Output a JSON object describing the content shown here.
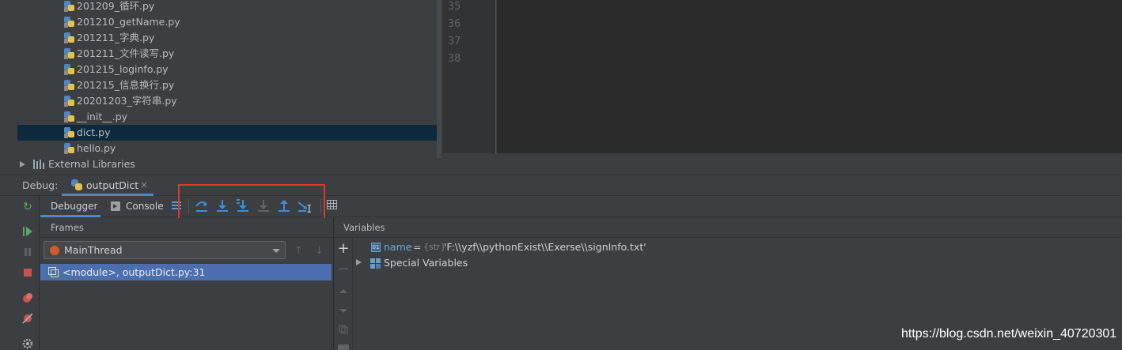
{
  "project_tree": {
    "files": [
      {
        "label": "201209_循环.py",
        "selected": false
      },
      {
        "label": "201210_getName.py",
        "selected": false
      },
      {
        "label": "201211_字典.py",
        "selected": false
      },
      {
        "label": "201211_文件读写.py",
        "selected": false
      },
      {
        "label": "201215_loginfo.py",
        "selected": false
      },
      {
        "label": "201215_信息换行.py",
        "selected": false
      },
      {
        "label": "20201203_字符串.py",
        "selected": false
      },
      {
        "label": "__init__.py",
        "selected": false
      },
      {
        "label": "dict.py",
        "selected": true
      },
      {
        "label": "hello.py",
        "selected": false
      }
    ],
    "external_libraries": "External Libraries"
  },
  "editor": {
    "line_numbers": [
      "35",
      "36",
      "37",
      "38"
    ]
  },
  "debug": {
    "label": "Debug:",
    "run_config": "outputDict",
    "close_glyph": "×",
    "tabs": {
      "debugger": "Debugger",
      "console": "Console"
    },
    "frames_title": "Frames",
    "variables_title": "Variables",
    "thread": "MainThread",
    "frame": "<module>, outputDict.py:31",
    "variables": {
      "name": "name",
      "eq": "=",
      "type": "{str}",
      "value": "'F:\\\\yzf\\\\pythonExist\\\\Exerse\\\\signInfo.txt'",
      "special": "Special Variables"
    },
    "toolbar_buttons": [
      "step-over",
      "step-into",
      "step-into-my-code",
      "force-step-into",
      "step-out",
      "run-to-cursor"
    ],
    "colors": {
      "accent": "#4a88c7",
      "selection": "#4b6eaf",
      "highlight_box": "#e0362f"
    }
  },
  "watermark": "https://blog.csdn.net/weixin_40720301"
}
